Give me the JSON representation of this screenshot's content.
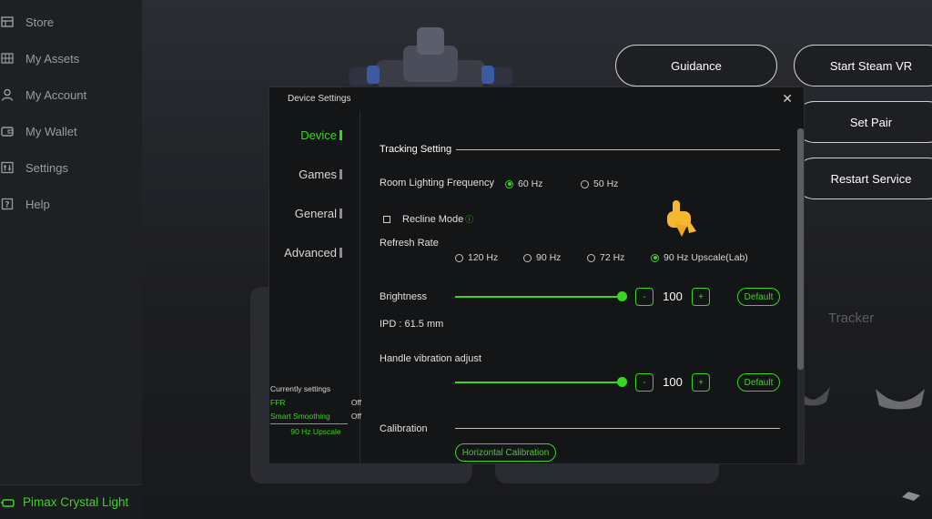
{
  "sidebar": {
    "items": [
      {
        "label": "Store",
        "icon": "store-icon"
      },
      {
        "label": "My Assets",
        "icon": "grid-icon"
      },
      {
        "label": "My Account",
        "icon": "person-icon"
      },
      {
        "label": "My Wallet",
        "icon": "wallet-icon"
      },
      {
        "label": "Settings",
        "icon": "sliders-icon"
      },
      {
        "label": "Help",
        "icon": "help-icon"
      }
    ],
    "device_name": "Pimax Crystal Light"
  },
  "top_buttons": {
    "guidance": "Guidance",
    "start_steam_vr": "Start Steam VR",
    "set_pair": "Set Pair",
    "restart_service": "Restart Service"
  },
  "tracker_label": "Tracker",
  "dialog": {
    "title": "Device Settings",
    "close": "✕",
    "categories": [
      "Device",
      "Games",
      "General",
      "Advanced"
    ],
    "active_category": "Device",
    "current_settings": {
      "title": "Currently settings",
      "rows": [
        {
          "name": "FFR",
          "value": "Off"
        },
        {
          "name": "Smart Smoothing",
          "value": "Off"
        }
      ],
      "mode": "90 Hz Upscale"
    },
    "tracking": {
      "heading": "Tracking Setting",
      "room_lighting_label": "Room Lighting Frequency",
      "room_lighting_options": [
        "60 Hz",
        "50 Hz"
      ],
      "room_lighting_selected": "60 Hz",
      "recline_mode_label": "Recline Mode",
      "recline_mode_checked": false,
      "refresh_rate_label": "Refresh Rate",
      "refresh_rate_options": [
        "120 Hz",
        "90 Hz",
        "72 Hz",
        "90 Hz Upscale(Lab)"
      ],
      "refresh_rate_selected": "90 Hz Upscale(Lab)"
    },
    "brightness": {
      "label": "Brightness",
      "value": "100",
      "minus": "-",
      "plus": "+",
      "default_label": "Default"
    },
    "ipd": "IPD : 61.5 mm",
    "handle_vibration": {
      "label": "Handle vibration adjust",
      "value": "100",
      "minus": "-",
      "plus": "+",
      "default_label": "Default"
    },
    "calibration": {
      "heading": "Calibration",
      "horizontal_button": "Horizontal Calibration"
    }
  },
  "colors": {
    "accent": "#39d620",
    "background": "#1c1d21",
    "dialog": "#141517"
  }
}
